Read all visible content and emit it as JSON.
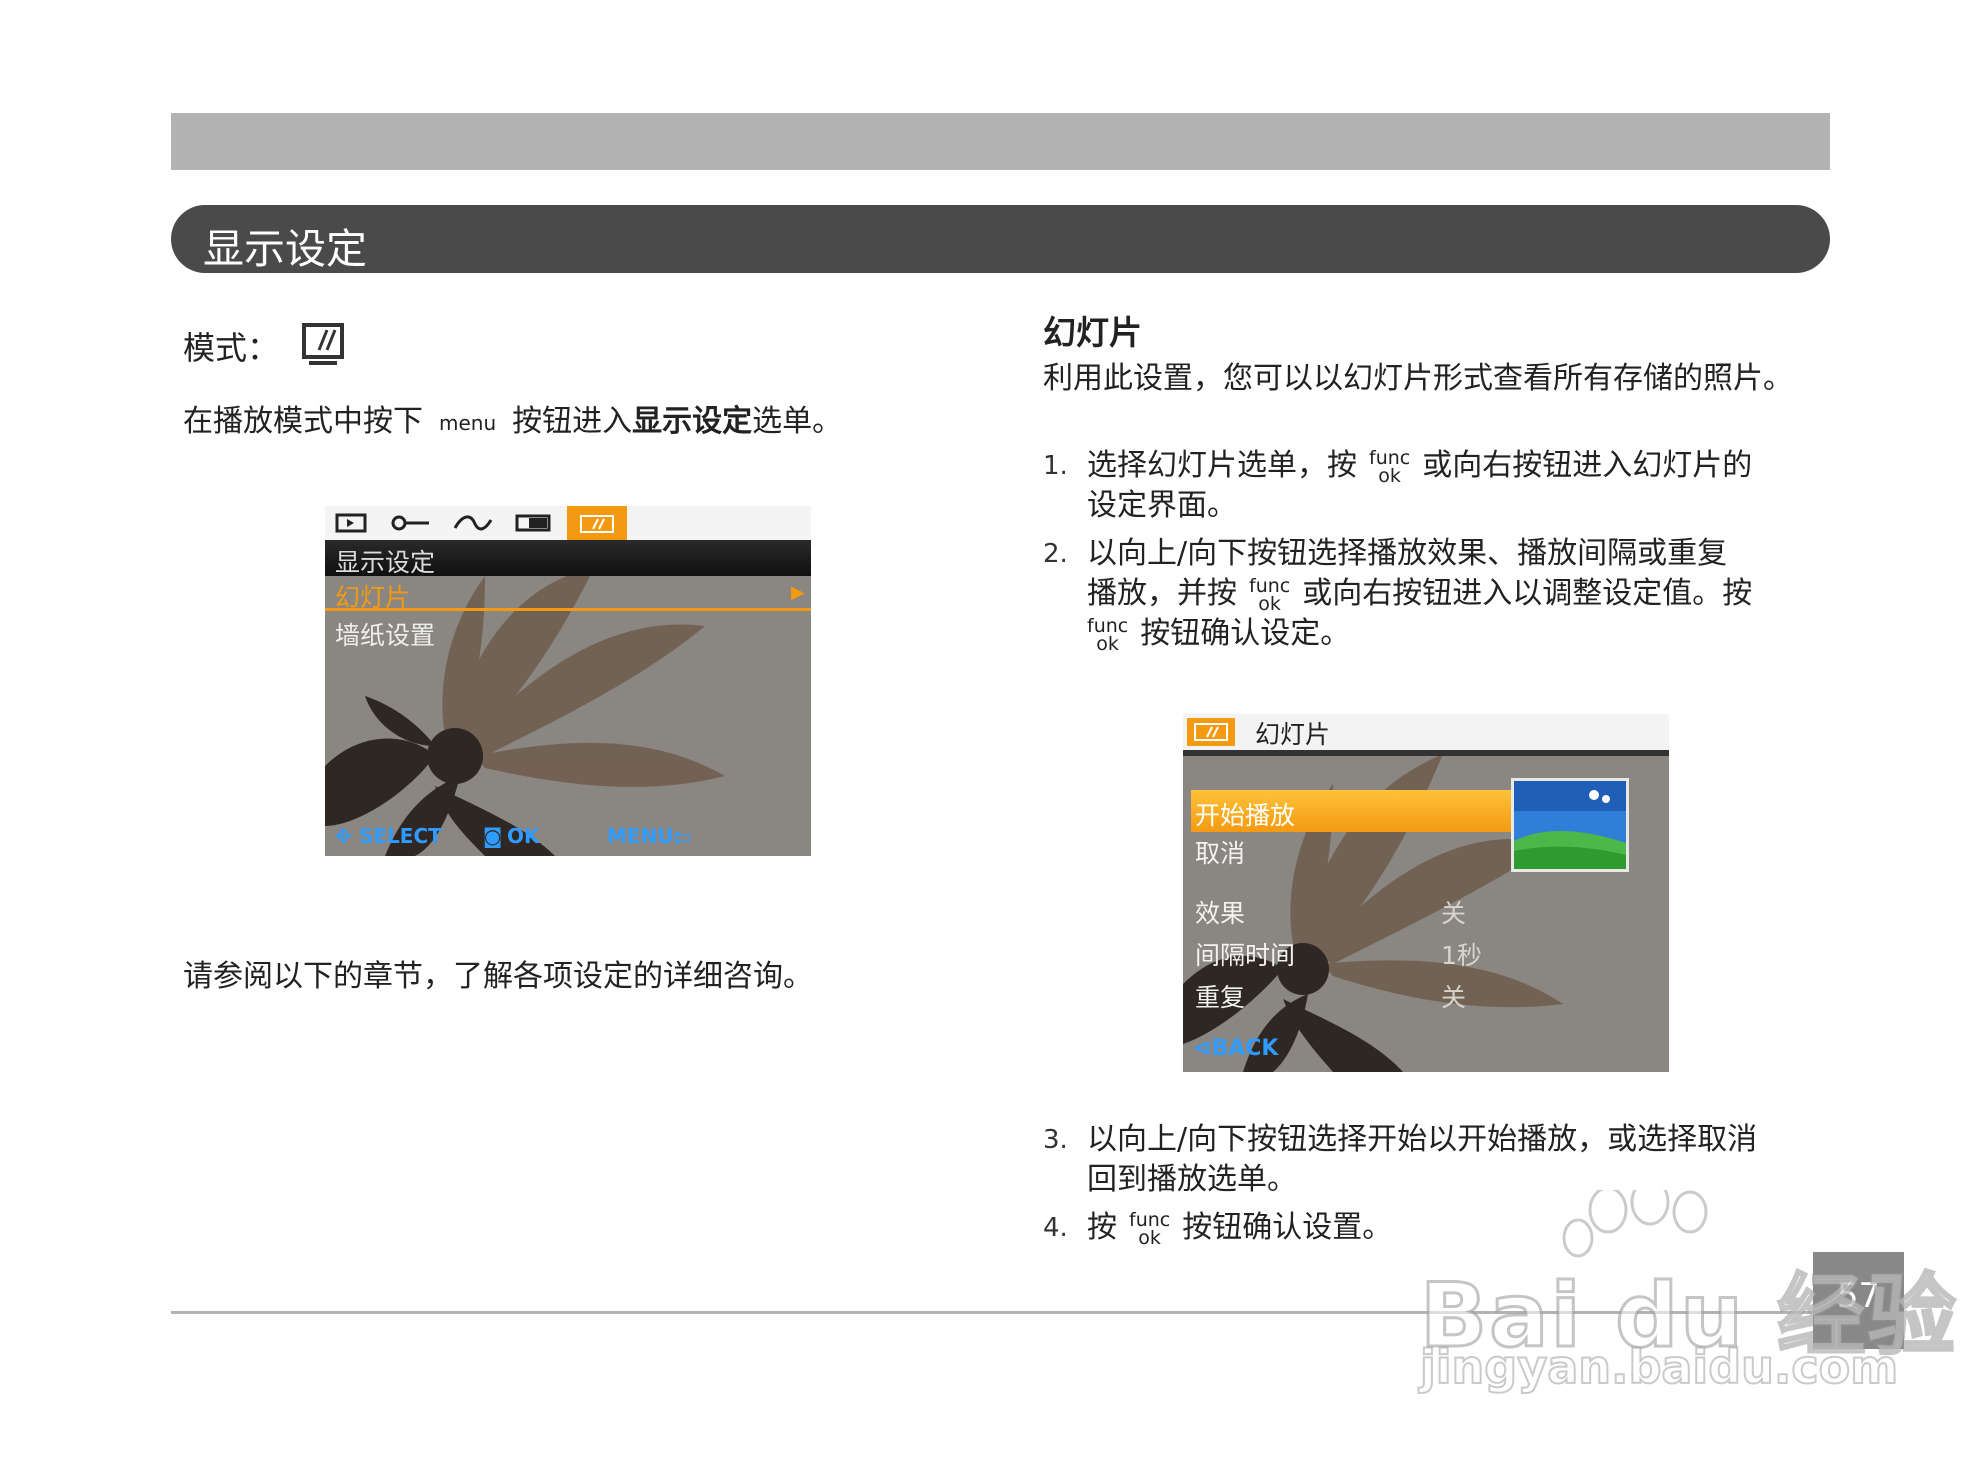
{
  "section": {
    "title": "显示设定"
  },
  "left": {
    "mode_label": "模式：",
    "intro_before": "在播放模式中按下",
    "intro_menu_key": "menu",
    "intro_middle": "按钮进入",
    "intro_bold": "显示设定",
    "intro_after": "选单。",
    "reference": "请参阅以下的章节，了解各项设定的详细咨询。"
  },
  "screen1": {
    "header": "显示设定",
    "item_selected": "幻灯片",
    "item_2": "墙纸设置",
    "bottom_select": "SELECT",
    "bottom_ok": "OK",
    "bottom_menu": "MENU:"
  },
  "right": {
    "heading": "幻灯片",
    "description": "利用此设置，您可以以幻灯片形式查看所有存储的照片。",
    "func_top": "func",
    "func_bottom": "ok",
    "steps": [
      {
        "num": "1.",
        "a": "选择幻灯片选单，按",
        "b": "或向右按钮进入幻灯片的",
        "c": "设定界面。"
      },
      {
        "num": "2.",
        "a": "以向上/向下按钮选择播放效果、播放间隔或重复",
        "b": "播放，并按",
        "c": "或向右按钮进入以调整设定值。按",
        "d": "按钮确认设定。"
      },
      {
        "num": "3.",
        "a": "以向上/向下按钮选择开始以开始播放，或选择取消",
        "b": "回到播放选单。"
      },
      {
        "num": "4.",
        "a": "按",
        "b": "按钮确认设置。"
      }
    ]
  },
  "screen2": {
    "header": "幻灯片",
    "start": "开始播放",
    "cancel": "取消",
    "effect": "效果",
    "effect_val": "关",
    "interval": "间隔时间",
    "interval_val": "1秒",
    "repeat": "重复",
    "repeat_val": "关",
    "back": "BACK"
  },
  "page_number": "57",
  "watermark": {
    "brand": "Bai du 经验",
    "url": "jingyan.baidu.com"
  }
}
